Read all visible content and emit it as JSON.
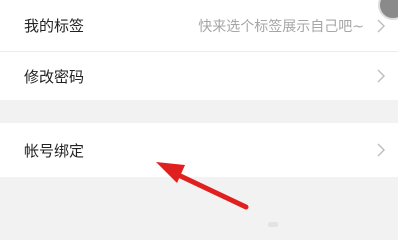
{
  "settings": {
    "my_tags": {
      "label": "我的标签",
      "value": "快来选个标签展示自己吧~"
    },
    "change_password": {
      "label": "修改密码"
    },
    "account_binding": {
      "label": "帐号绑定"
    }
  },
  "annotation": {
    "arrow_color": "#e0201e"
  },
  "colors": {
    "background": "#f2f2f2",
    "row": "#ffffff",
    "label_text": "#222222",
    "hint_text": "#a6a6a6",
    "chevron": "#bdbdbd"
  },
  "icons": {
    "chevron": "chevron-right-icon",
    "corner_avatar": "avatar"
  }
}
